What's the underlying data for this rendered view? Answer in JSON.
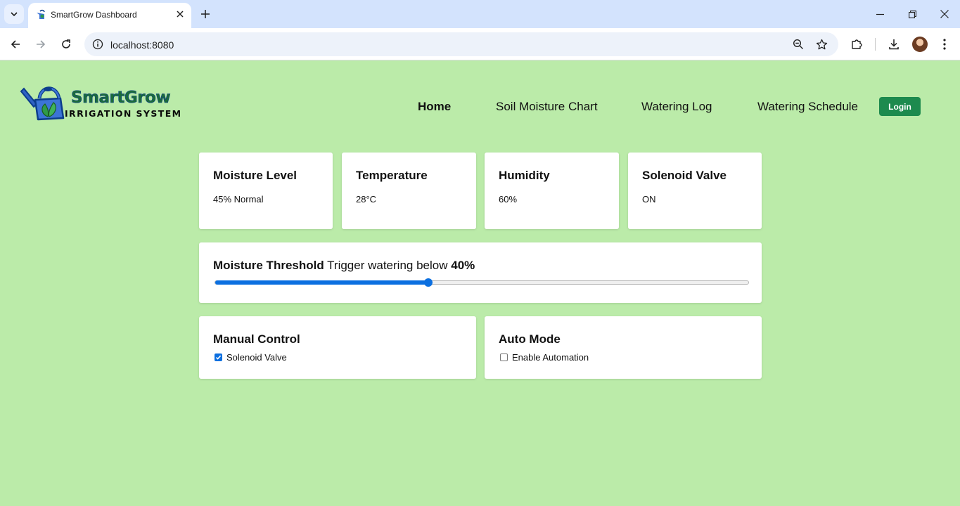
{
  "browser": {
    "tab_title": "SmartGrow Dashboard",
    "url": "localhost:8080"
  },
  "brand": {
    "name": "SmartGrow",
    "tagline": "IRRIGATION SYSTEM"
  },
  "nav": {
    "items": [
      {
        "label": "Home",
        "active": true
      },
      {
        "label": "Soil Moisture Chart",
        "active": false
      },
      {
        "label": "Watering Log",
        "active": false
      },
      {
        "label": "Watering Schedule",
        "active": false
      }
    ],
    "login_label": "Login"
  },
  "stats": [
    {
      "title": "Moisture Level",
      "value": "45% Normal"
    },
    {
      "title": "Temperature",
      "value": "28°C"
    },
    {
      "title": "Humidity",
      "value": "60%"
    },
    {
      "title": "Solenoid Valve",
      "value": "ON"
    }
  ],
  "threshold": {
    "title": "Moisture Threshold",
    "text": "Trigger watering below",
    "value_label": "40%",
    "value": 40,
    "max": 100
  },
  "manual_control": {
    "title": "Manual Control",
    "checkbox_label": "Solenoid Valve",
    "checked": true
  },
  "auto_mode": {
    "title": "Auto Mode",
    "checkbox_label": "Enable Automation",
    "checked": false
  },
  "colors": {
    "page_background": "#bbeba9",
    "accent": "#0b6fe0",
    "login_button": "#1d8a4e"
  }
}
